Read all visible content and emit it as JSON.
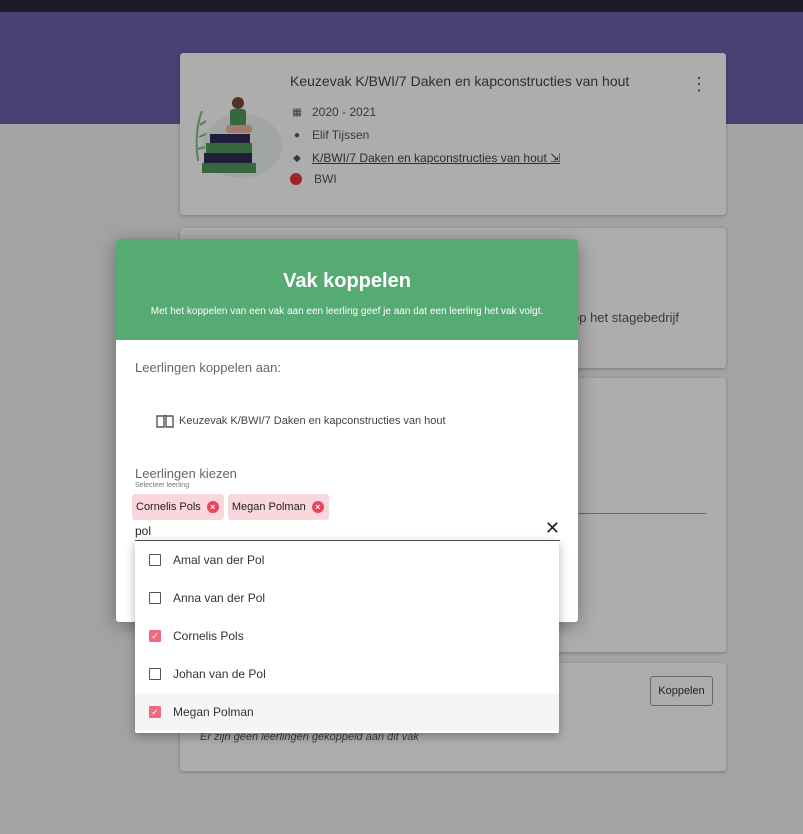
{
  "course": {
    "title": "Keuzevak K/BWI/7 Daken en kapconstructies van hout",
    "year": "2020 - 2021",
    "teacher": "Elif Tijssen",
    "link": "K/BWI/7 Daken en kapconstructies van hout ⇲",
    "department": "BWI",
    "department_color": "#e53935"
  },
  "background": {
    "card2_text": "op het stagebedrijf",
    "koppelen_button": "Koppelen",
    "empty_note": "Er zijn geen leerlingen gekoppeld aan dit vak"
  },
  "dialog": {
    "title": "Vak koppelen",
    "subtitle": "Met het koppelen van een vak aan een leerling geef je aan dat een leerling het vak volgt.",
    "link_label": "Leerlingen koppelen aan:",
    "course_ref": "Keuzevak K/BWI/7 Daken en kapconstructies van hout",
    "choose_label": "Leerlingen kiezen",
    "select_hint": "Selecteer leerling",
    "chips": [
      {
        "label": "Cornelis Pols"
      },
      {
        "label": "Megan Polman"
      }
    ],
    "search_value": "pol",
    "header_color": "#56aa74"
  },
  "options": [
    {
      "label": "Amal van der Pol",
      "checked": false
    },
    {
      "label": "Anna van der Pol",
      "checked": false
    },
    {
      "label": "Cornelis Pols",
      "checked": true
    },
    {
      "label": "Johan van de Pol",
      "checked": false
    },
    {
      "label": "Megan Polman",
      "checked": true
    }
  ]
}
